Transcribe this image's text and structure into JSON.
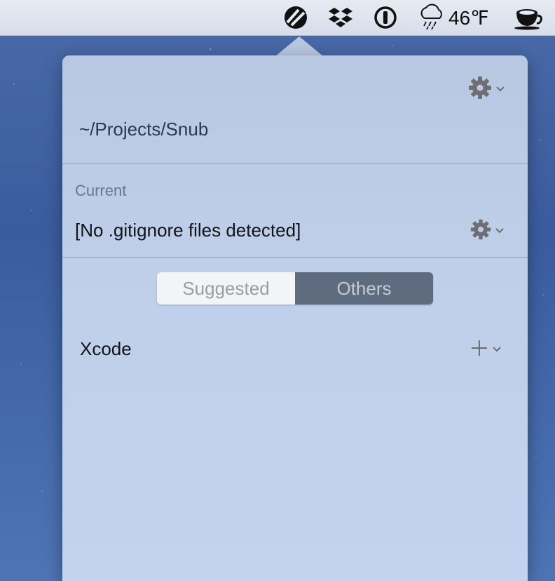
{
  "menubar": {
    "icons": [
      "snub-icon",
      "dropbox-icon",
      "password-manager-icon",
      "weather-rain-icon",
      "coffee-cup-icon"
    ],
    "weather_text": "46℉"
  },
  "popover": {
    "project_path": "~/Projects/Snub",
    "current_section": {
      "label": "Current",
      "value": "[No .gitignore files detected]"
    },
    "tabs": [
      {
        "label": "Suggested",
        "selected": false
      },
      {
        "label": "Others",
        "selected": true
      }
    ],
    "items": [
      {
        "label": "Xcode"
      }
    ]
  },
  "colors": {
    "popover_bg": "#bfcfe9",
    "selected_tab_bg": "#5f6b7e",
    "unselected_tab_bg": "#f3f4f6"
  }
}
